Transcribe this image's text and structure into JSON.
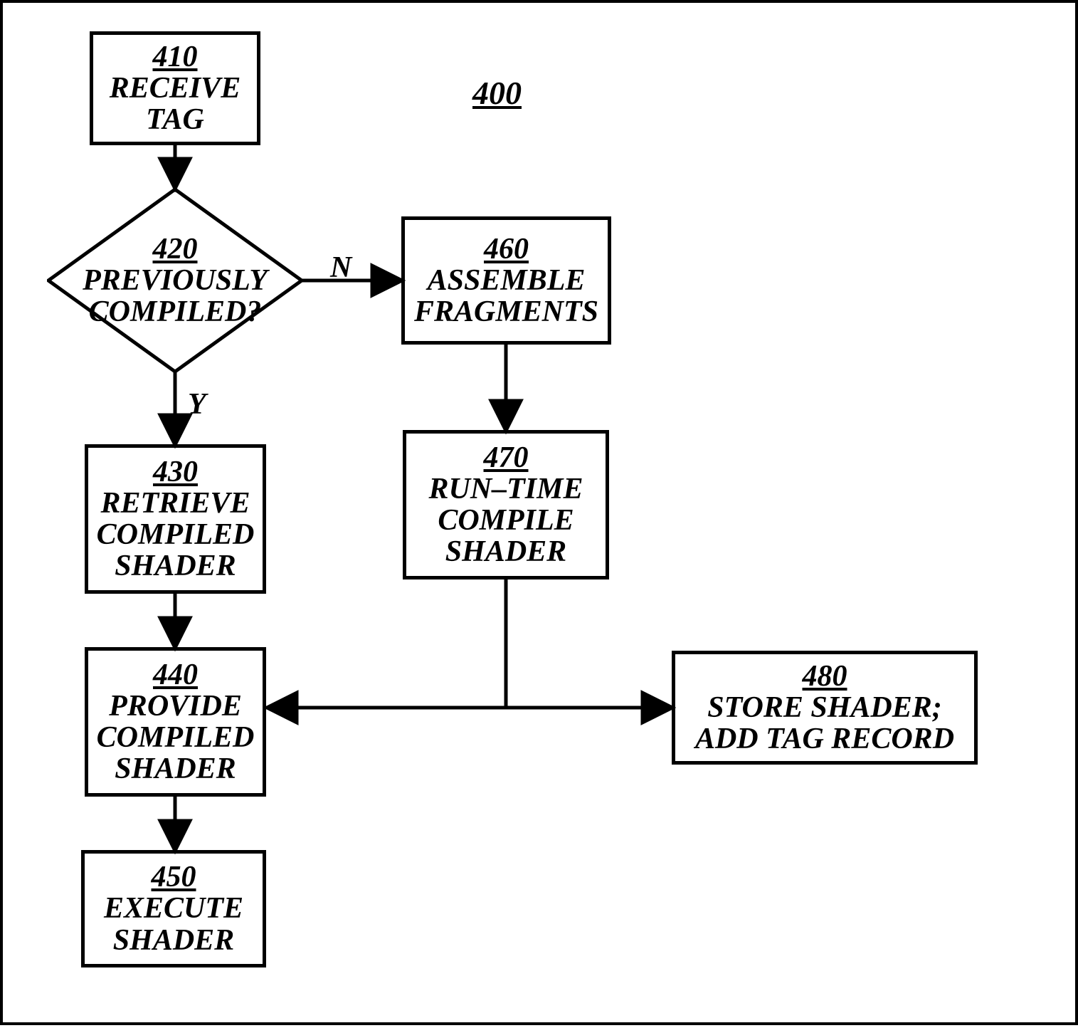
{
  "diagram_label": "400",
  "nodes": {
    "n410": {
      "num": "410",
      "text": "RECEIVE\nTAG"
    },
    "n420": {
      "num": "420",
      "text": "PREVIOUSLY\nCOMPILED?"
    },
    "n430": {
      "num": "430",
      "text": "RETRIEVE\nCOMPILED\nSHADER"
    },
    "n440": {
      "num": "440",
      "text": "PROVIDE\nCOMPILED\nSHADER"
    },
    "n450": {
      "num": "450",
      "text": "EXECUTE\nSHADER"
    },
    "n460": {
      "num": "460",
      "text": "ASSEMBLE\nFRAGMENTS"
    },
    "n470": {
      "num": "470",
      "text": "RUN–TIME\nCOMPILE\nSHADER"
    },
    "n480": {
      "num": "480",
      "text": "STORE SHADER;\nADD TAG RECORD"
    }
  },
  "branches": {
    "yes": "Y",
    "no": "N"
  }
}
